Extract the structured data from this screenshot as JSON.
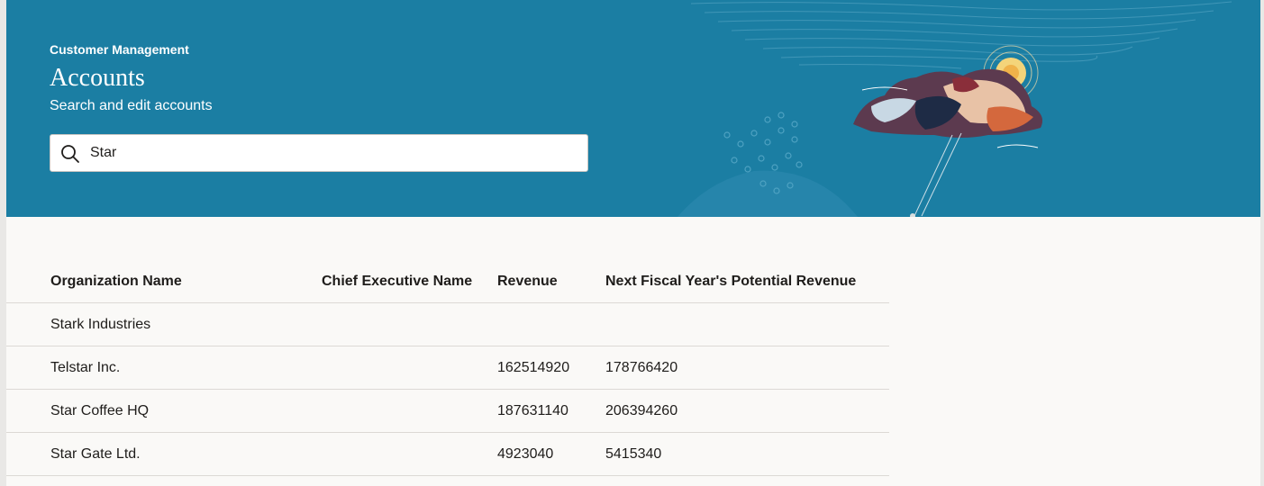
{
  "header": {
    "eyebrow": "Customer Management",
    "title": "Accounts",
    "subtitle": "Search and edit accounts"
  },
  "search": {
    "value": "Star",
    "icon": "search-icon"
  },
  "table": {
    "columns": [
      "Organization Name",
      "Chief Executive Name",
      "Revenue",
      "Next Fiscal Year's Potential Revenue"
    ],
    "rows": [
      [
        "Stark Industries",
        "",
        "",
        ""
      ],
      [
        "Telstar Inc.",
        "",
        "162514920",
        "178766420"
      ],
      [
        "Star Coffee HQ",
        "",
        "187631140",
        "206394260"
      ],
      [
        "Star Gate Ltd.",
        "",
        "4923040",
        "5415340"
      ]
    ]
  },
  "colors": {
    "hero": "#1b7ea3",
    "page": "#faf9f7"
  }
}
